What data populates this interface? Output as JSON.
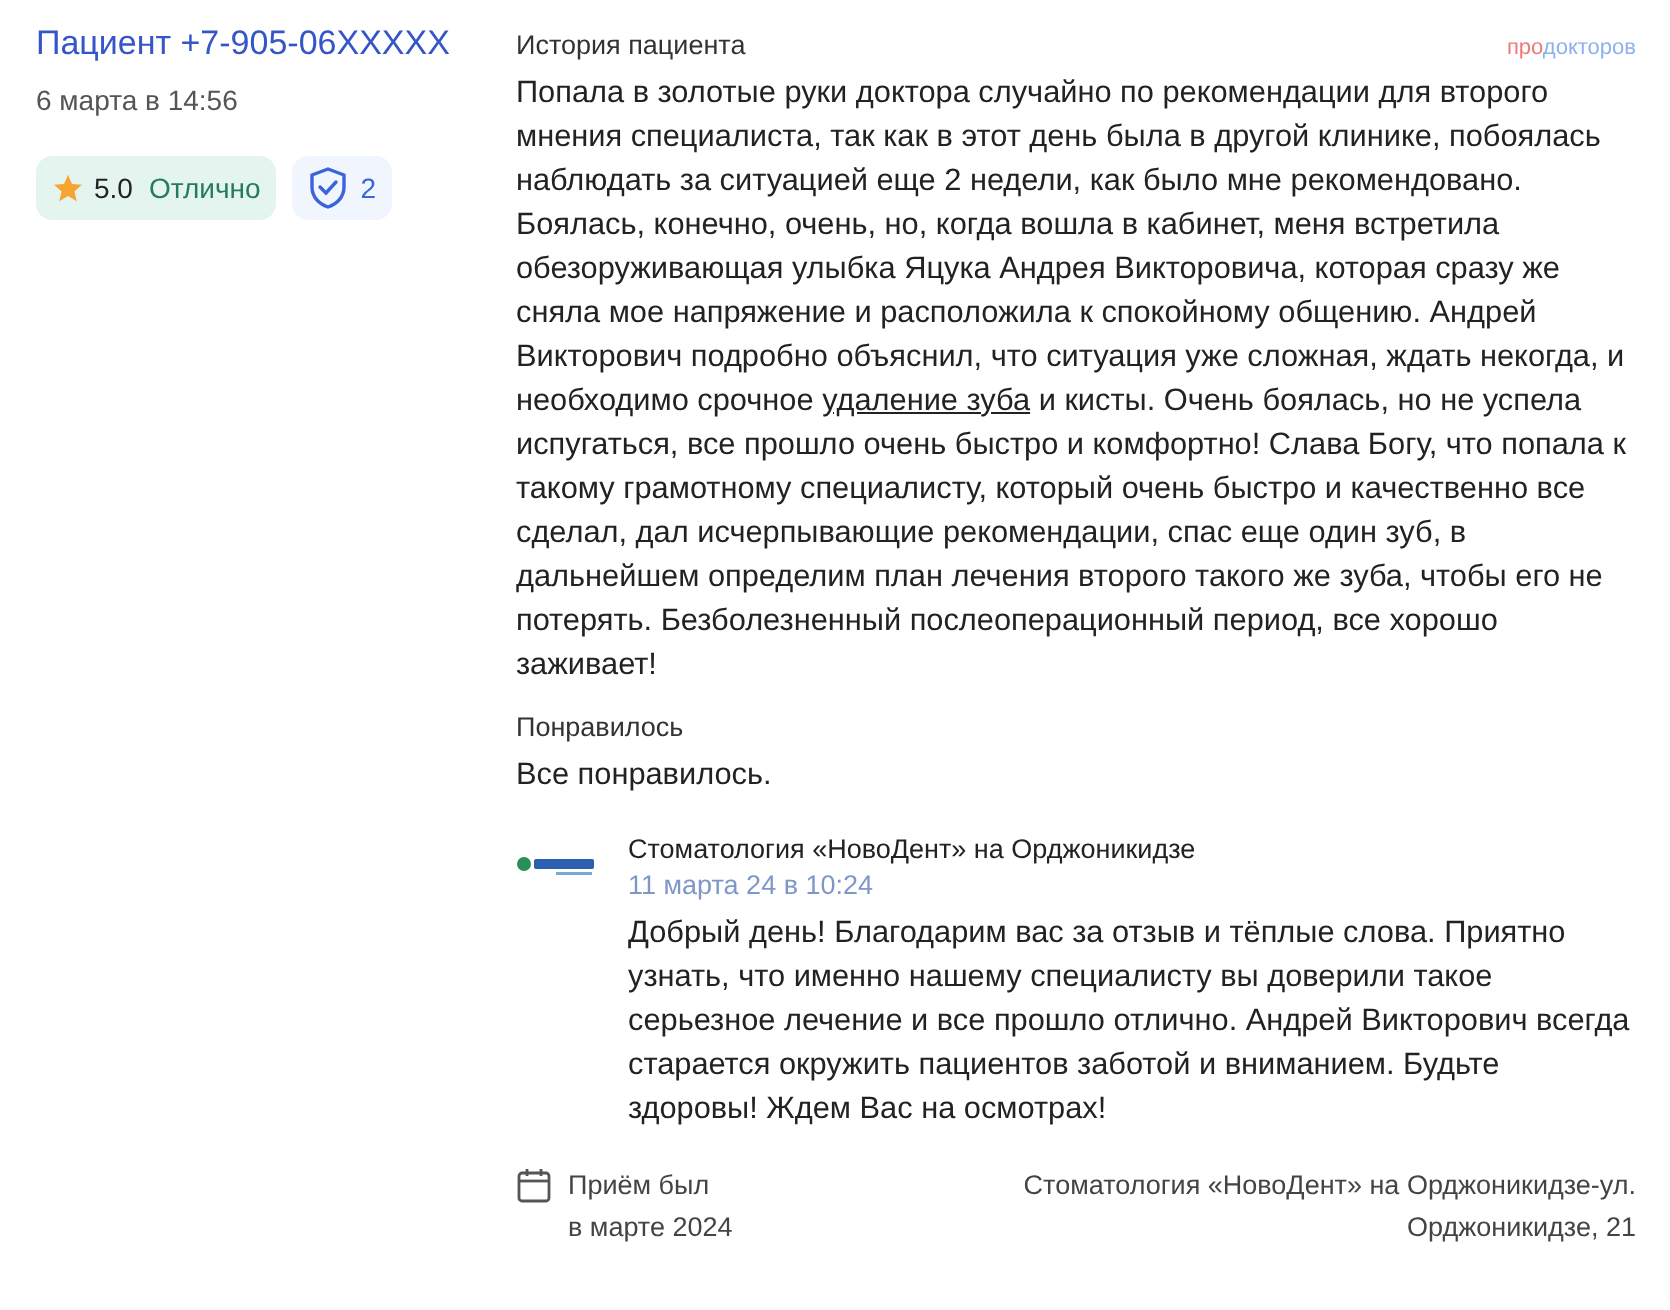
{
  "author": {
    "name": "Пациент +7-905-06XXXXX",
    "date": "6 марта в 14:56"
  },
  "rating": {
    "score": "5.0",
    "verdict": "Отлично"
  },
  "verified": {
    "count": "2"
  },
  "brand": {
    "part_1": "про",
    "part_2": "докторов"
  },
  "history": {
    "heading": "История пациента",
    "segments": [
      {
        "kind": "text",
        "text": "Попала в золотые руки доктора случайно по рекомендации для второго мнения специалиста, так как в этот день была в другой клинике, побоялась наблюдать за ситуацией еще 2 недели, как было мне рекомендовано. Боялась, конечно, очень, но, когда вошла в кабинет, меня встретила обезоруживающая улыбка Яцука Андрея Викторовича, которая сразу же сняла мое напряжение и расположила к спокойному общению. Андрей Викторович подробно объяснил, что ситуация уже сложная, ждать некогда, и необходимо срочное "
      },
      {
        "kind": "link",
        "text": "удаление зуба"
      },
      {
        "kind": "text",
        "text": " и кисты. Очень боялась, но не успела испугаться, все прошло очень быстро и комфортно! Слава Богу, что попала к такому грамотному специалисту, который очень быстро и качественно все сделал, дал исчерпывающие рекомендации, спас еще один зуб, в дальнейшем определим план лечения второго такого же зуба, чтобы его не потерять. Безболезненный послеоперационный период, все хорошо заживает!"
      }
    ]
  },
  "liked": {
    "heading": "Понравилось",
    "text": "Все понравилось."
  },
  "reply": {
    "clinic": "Стоматология «НовоДент» на Орджоникидзе",
    "date": "11 марта 24 в 10:24",
    "text": "Добрый день! Благодарим вас за отзыв и тёплые слова. Приятно узнать, что именно нашему специалисту вы доверили такое серьезное лечение и все прошло отлично. Андрей Викторович всегда старается окружить пациентов заботой и вниманием. Будьте здоровы! Ждем Вас на осмотрах!"
  },
  "visit": {
    "line_1": "Приём был",
    "line_2": "в марте 2024"
  },
  "location": {
    "line_1": "Стоматология «НовоДент» на Орджоникидзе-ул.",
    "line_2": "Орджоникидзе, 21"
  }
}
